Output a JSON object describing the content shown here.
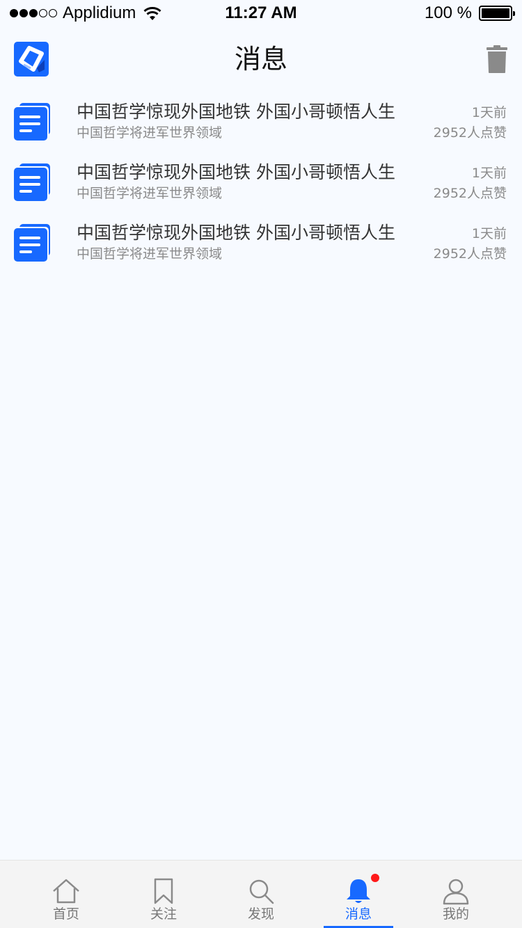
{
  "status_bar": {
    "carrier": "Applidium",
    "time": "11:27 AM",
    "battery_text": "100 %",
    "signal_dots_filled": 3,
    "signal_dots_total": 5
  },
  "header": {
    "title": "消息",
    "logo_icon": "app-logo-icon",
    "delete_icon": "trash-icon"
  },
  "colors": {
    "accent": "#1769ff",
    "background": "#f7faff",
    "badge": "#ff1a1a"
  },
  "messages": [
    {
      "title": "中国哲学惊现外国地铁 外国小哥顿悟人生",
      "subtitle": "中国哲学将进军世界领域",
      "time": "1天前",
      "likes": "2952人点赞",
      "icon": "document-icon"
    },
    {
      "title": "中国哲学惊现外国地铁 外国小哥顿悟人生",
      "subtitle": "中国哲学将进军世界领域",
      "time": "1天前",
      "likes": "2952人点赞",
      "icon": "document-icon"
    },
    {
      "title": "中国哲学惊现外国地铁 外国小哥顿悟人生",
      "subtitle": "中国哲学将进军世界领域",
      "time": "1天前",
      "likes": "2952人点赞",
      "icon": "document-icon"
    }
  ],
  "tabs": [
    {
      "label": "首页",
      "icon": "home-icon",
      "active": false
    },
    {
      "label": "关注",
      "icon": "bookmark-icon",
      "active": false
    },
    {
      "label": "发现",
      "icon": "search-icon",
      "active": false
    },
    {
      "label": "消息",
      "icon": "bell-icon",
      "active": true,
      "has_badge": true
    },
    {
      "label": "我的",
      "icon": "profile-icon",
      "active": false
    }
  ]
}
